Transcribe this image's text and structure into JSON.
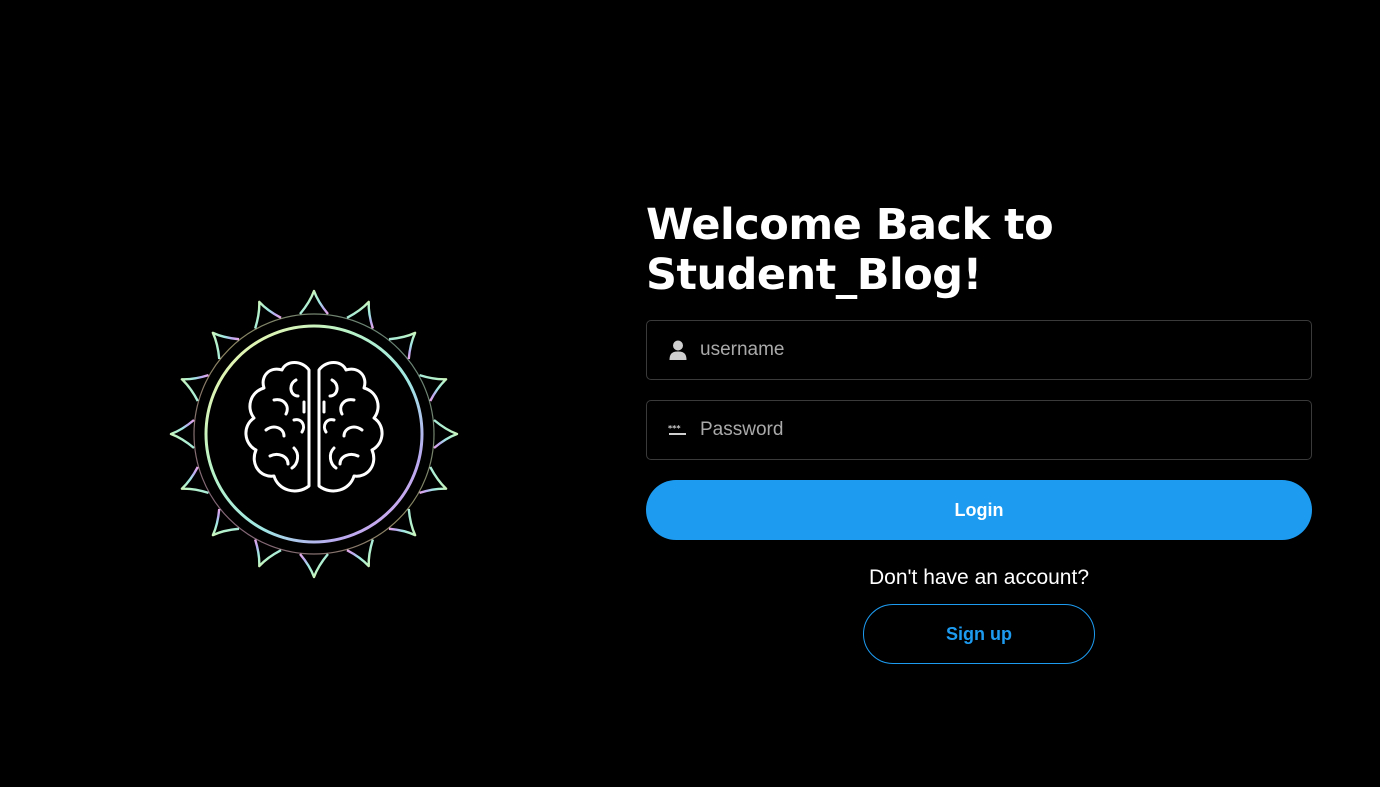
{
  "app": {
    "logo_name": "brain-lotus-logo",
    "title": "Welcome Back to Student_Blog!"
  },
  "form": {
    "username": {
      "placeholder": "username",
      "value": "",
      "icon": "user-icon"
    },
    "password": {
      "placeholder": "Password",
      "value": "",
      "icon": "password-dots-icon"
    },
    "login_label": "Login"
  },
  "signup": {
    "prompt": "Don't have an account?",
    "button_label": "Sign up"
  },
  "colors": {
    "background": "#000000",
    "accent": "#1d9bf0",
    "field_border": "#3a3a3a",
    "placeholder": "#a9a9a9",
    "text": "#ffffff"
  }
}
